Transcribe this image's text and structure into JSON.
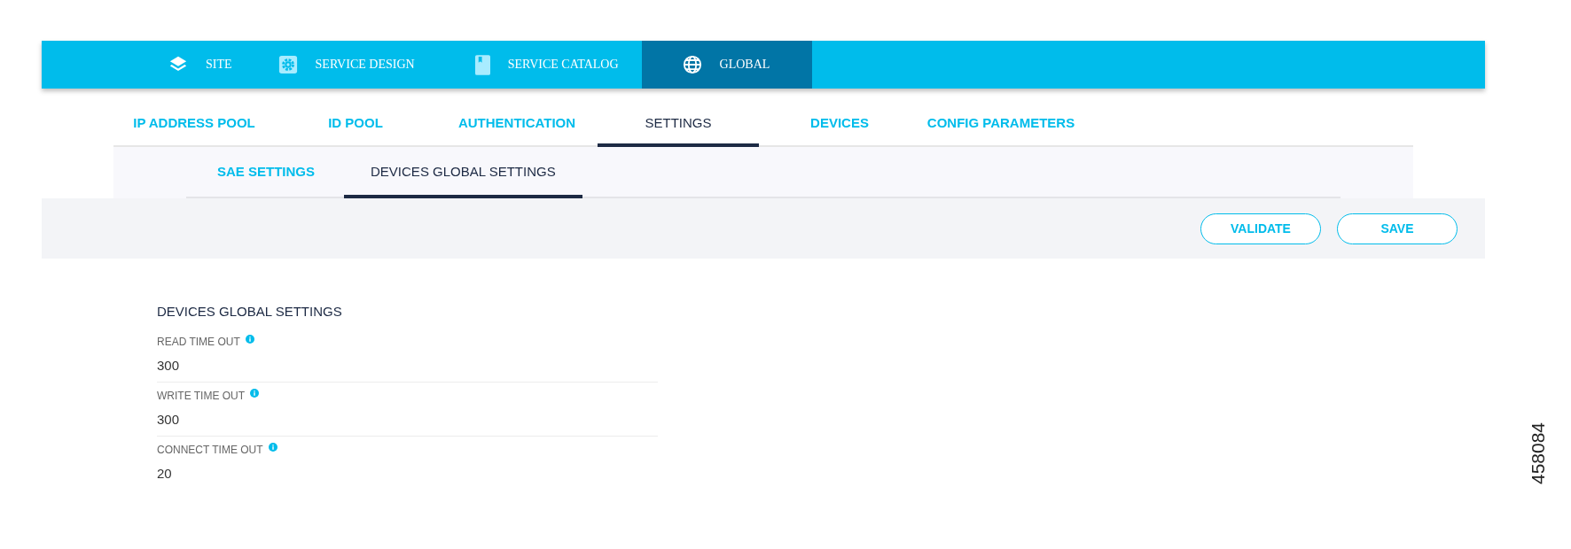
{
  "nav": [
    {
      "label": "SITE",
      "selected": false
    },
    {
      "label": "SERVICE DESIGN",
      "selected": false
    },
    {
      "label": "SERVICE CATALOG",
      "selected": false
    },
    {
      "label": "GLOBAL",
      "selected": true
    }
  ],
  "tabs": [
    {
      "label": "IP ADDRESS POOL",
      "selected": false
    },
    {
      "label": "ID POOL",
      "selected": false
    },
    {
      "label": "AUTHENTICATION",
      "selected": false
    },
    {
      "label": "SETTINGS",
      "selected": true
    },
    {
      "label": "DEVICES",
      "selected": false
    },
    {
      "label": "CONFIG PARAMETERS",
      "selected": false
    }
  ],
  "subtabs": [
    {
      "label": "SAE SETTINGS",
      "selected": false
    },
    {
      "label": "DEVICES GLOBAL SETTINGS",
      "selected": true
    }
  ],
  "buttons": [
    "VALIDATE",
    "SAVE"
  ],
  "form": {
    "title": "DEVICES GLOBAL SETTINGS",
    "fields": [
      {
        "label": "READ TIME OUT",
        "value": "300"
      },
      {
        "label": "WRITE TIME OUT",
        "value": "300"
      },
      {
        "label": "CONNECT TIME OUT",
        "value": "20"
      }
    ]
  },
  "figure_number": "458084"
}
